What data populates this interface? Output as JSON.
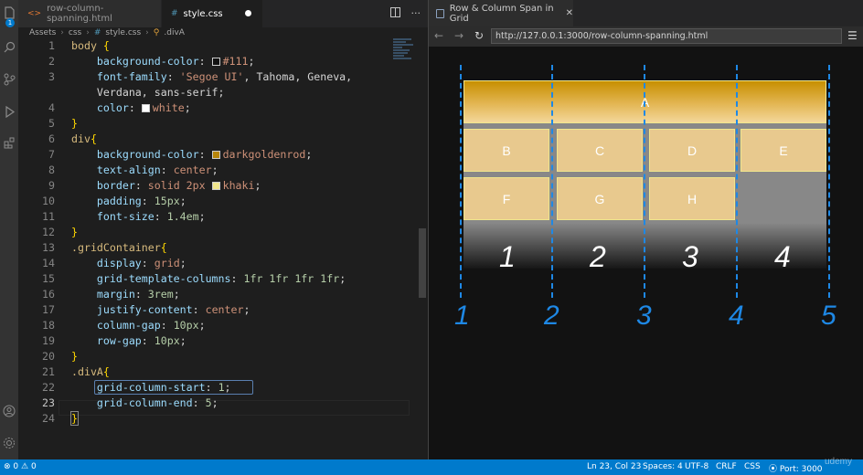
{
  "editor": {
    "tabs": [
      {
        "label": "row-column-spanning.html"
      },
      {
        "label": "style.css"
      }
    ],
    "breadcrumb": [
      "Assets",
      "css",
      "style.css",
      ".divA"
    ],
    "notifications_badge": "1"
  },
  "code": {
    "lines": [
      {
        "n": "1"
      },
      {
        "n": "2"
      },
      {
        "n": "3"
      },
      {
        "n": ""
      },
      {
        "n": "4"
      },
      {
        "n": "5"
      },
      {
        "n": "6"
      },
      {
        "n": "7"
      },
      {
        "n": "8"
      },
      {
        "n": "9"
      },
      {
        "n": "10"
      },
      {
        "n": "11"
      },
      {
        "n": "12"
      },
      {
        "n": "13"
      },
      {
        "n": "14"
      },
      {
        "n": "15"
      },
      {
        "n": "16"
      },
      {
        "n": "17"
      },
      {
        "n": "18"
      },
      {
        "n": "19"
      },
      {
        "n": "20"
      },
      {
        "n": "21"
      },
      {
        "n": "22"
      },
      {
        "n": "23"
      },
      {
        "n": "24"
      }
    ],
    "t": {
      "body": "body",
      "bg_prop": "background-color",
      "bg_val": "#111",
      "ff_prop": "font-family",
      "ff_val1": "'Segoe UI'",
      "ff_rest1": ", Tahoma, Geneva,",
      "ff_rest2": "Verdana, sans-serif",
      "color_prop": "color",
      "color_val": "white",
      "div": "div",
      "bg_val2": "darkgoldenrod",
      "ta_prop": "text-align",
      "ta_val": "center",
      "border_prop": "border",
      "border_val": "solid 2px",
      "border_color": "khaki",
      "pad_prop": "padding",
      "pad_val": "15px",
      "fs_prop": "font-size",
      "fs_val": "1.4em",
      "grid_sel": ".gridContainer",
      "disp_prop": "display",
      "disp_val": "grid",
      "gtc_prop": "grid-template-columns",
      "gtc_val": "1fr 1fr 1fr 1fr",
      "margin_prop": "margin",
      "margin_val": "3rem",
      "jc_prop": "justify-content",
      "jc_val": "center",
      "cg_prop": "column-gap",
      "cg_val": "10px",
      "rg_prop": "row-gap",
      "rg_val": "10px",
      "divA_sel": ".divA",
      "gcs_prop": "grid-column-start",
      "gcs_val": "1",
      "gce_prop": "grid-column-end",
      "gce_val": "5"
    },
    "colors": {
      "#111": "#111111",
      "darkgoldenrod": "#b8860b",
      "white": "#ffffff",
      "khaki": "#f0e68c"
    }
  },
  "browser": {
    "tab_title": "Row & Column Span in Grid",
    "url": "http://127.0.0.1:3000/row-column-spanning.html",
    "cells": [
      "A",
      "B",
      "C",
      "D",
      "E",
      "F",
      "G",
      "H"
    ],
    "track_numbers": [
      "1",
      "2",
      "3",
      "4"
    ],
    "line_numbers": [
      "1",
      "2",
      "3",
      "4",
      "5"
    ]
  },
  "status": {
    "problems": "0",
    "warnings": "0",
    "position": "Ln 23, Col 23",
    "spaces": "Spaces: 4",
    "encoding": "UTF-8",
    "eol": "CRLF",
    "language": "CSS",
    "port": "Port: 3000",
    "watermark": "udemy"
  }
}
